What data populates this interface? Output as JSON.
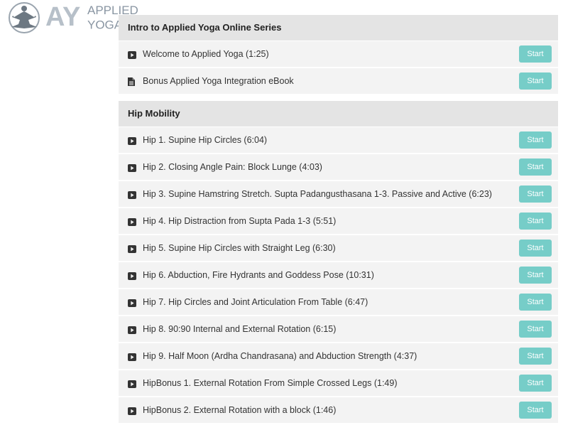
{
  "logo": {
    "mark_text": "AY",
    "line1": "APPLIED",
    "line2": "YOGA",
    "registered": "®"
  },
  "colors": {
    "accent": "#76cdc8",
    "section_bg": "#e4e4e4",
    "row_bg": "#f3f3f3"
  },
  "sections": [
    {
      "title": "Intro to Applied Yoga Online Series",
      "lessons": [
        {
          "icon": "video-play-icon",
          "title": "Welcome to Applied Yoga (1:25)",
          "action": "Start"
        },
        {
          "icon": "document-icon",
          "title": "Bonus Applied Yoga Integration eBook",
          "action": "Start"
        }
      ]
    },
    {
      "title": "Hip Mobility",
      "lessons": [
        {
          "icon": "video-play-icon",
          "title": "Hip 1. Supine Hip Circles (6:04)",
          "action": "Start"
        },
        {
          "icon": "video-play-icon",
          "title": "Hip 2. Closing Angle Pain: Block Lunge (4:03)",
          "action": "Start"
        },
        {
          "icon": "video-play-icon",
          "title": "Hip 3. Supine Hamstring Stretch. Supta Padangusthasana 1-3. Passive and Active (6:23)",
          "action": "Start"
        },
        {
          "icon": "video-play-icon",
          "title": "Hip 4. Hip Distraction from Supta Pada 1-3 (5:51)",
          "action": "Start"
        },
        {
          "icon": "video-play-icon",
          "title": "Hip 5. Supine Hip Circles with Straight Leg (6:30)",
          "action": "Start"
        },
        {
          "icon": "video-play-icon",
          "title": "Hip 6. Abduction, Fire Hydrants and Goddess Pose (10:31)",
          "action": "Start"
        },
        {
          "icon": "video-play-icon",
          "title": "Hip 7. Hip Circles and Joint Articulation From Table (6:47)",
          "action": "Start"
        },
        {
          "icon": "video-play-icon",
          "title": "Hip 8. 90:90 Internal and External Rotation (6:15)",
          "action": "Start"
        },
        {
          "icon": "video-play-icon",
          "title": "Hip 9. Half Moon (Ardha Chandrasana) and Abduction Strength (4:37)",
          "action": "Start"
        },
        {
          "icon": "video-play-icon",
          "title": "HipBonus 1. External Rotation From Simple Crossed Legs (1:49)",
          "action": "Start"
        },
        {
          "icon": "video-play-icon",
          "title": "HipBonus 2. External Rotation with a block (1:46)",
          "action": "Start"
        }
      ]
    }
  ]
}
